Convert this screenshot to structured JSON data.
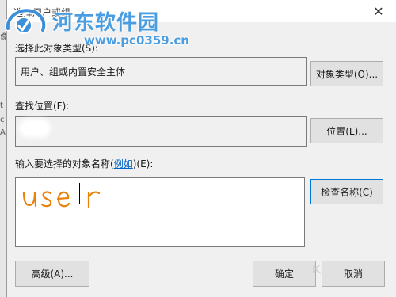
{
  "dialog": {
    "title": "选择用户或组",
    "close_glyph": "✕"
  },
  "background_window": {
    "glyphs": [
      "像",
      "t",
      "c",
      "AC"
    ]
  },
  "object_type": {
    "label": "选择此对象类型(S):",
    "value": "用户、组或内置安全主体",
    "button_label": "对象类型(O)..."
  },
  "location": {
    "label": "查找位置(F):",
    "value": "",
    "button_label": "位置(L)..."
  },
  "object_names": {
    "label_prefix": "输入要选择的对象名称(",
    "label_link": "例如",
    "label_suffix": ")(E):",
    "handwritten_value": "user",
    "check_button_label": "检查名称(C)"
  },
  "footer": {
    "advanced_label": "高级(A)...",
    "ok_label": "确定",
    "cancel_label": "取消"
  },
  "watermark": {
    "title": "河东软件园",
    "url": "www.pc0359.cn",
    "ghost": "K"
  },
  "colors": {
    "accent": "#0078d7",
    "link": "#0066cc",
    "watermark": "#4a9de0",
    "handwriting": "#e8820c"
  },
  "icons": {
    "close": "close-icon",
    "watermark_logo": "hedong-logo-icon"
  }
}
